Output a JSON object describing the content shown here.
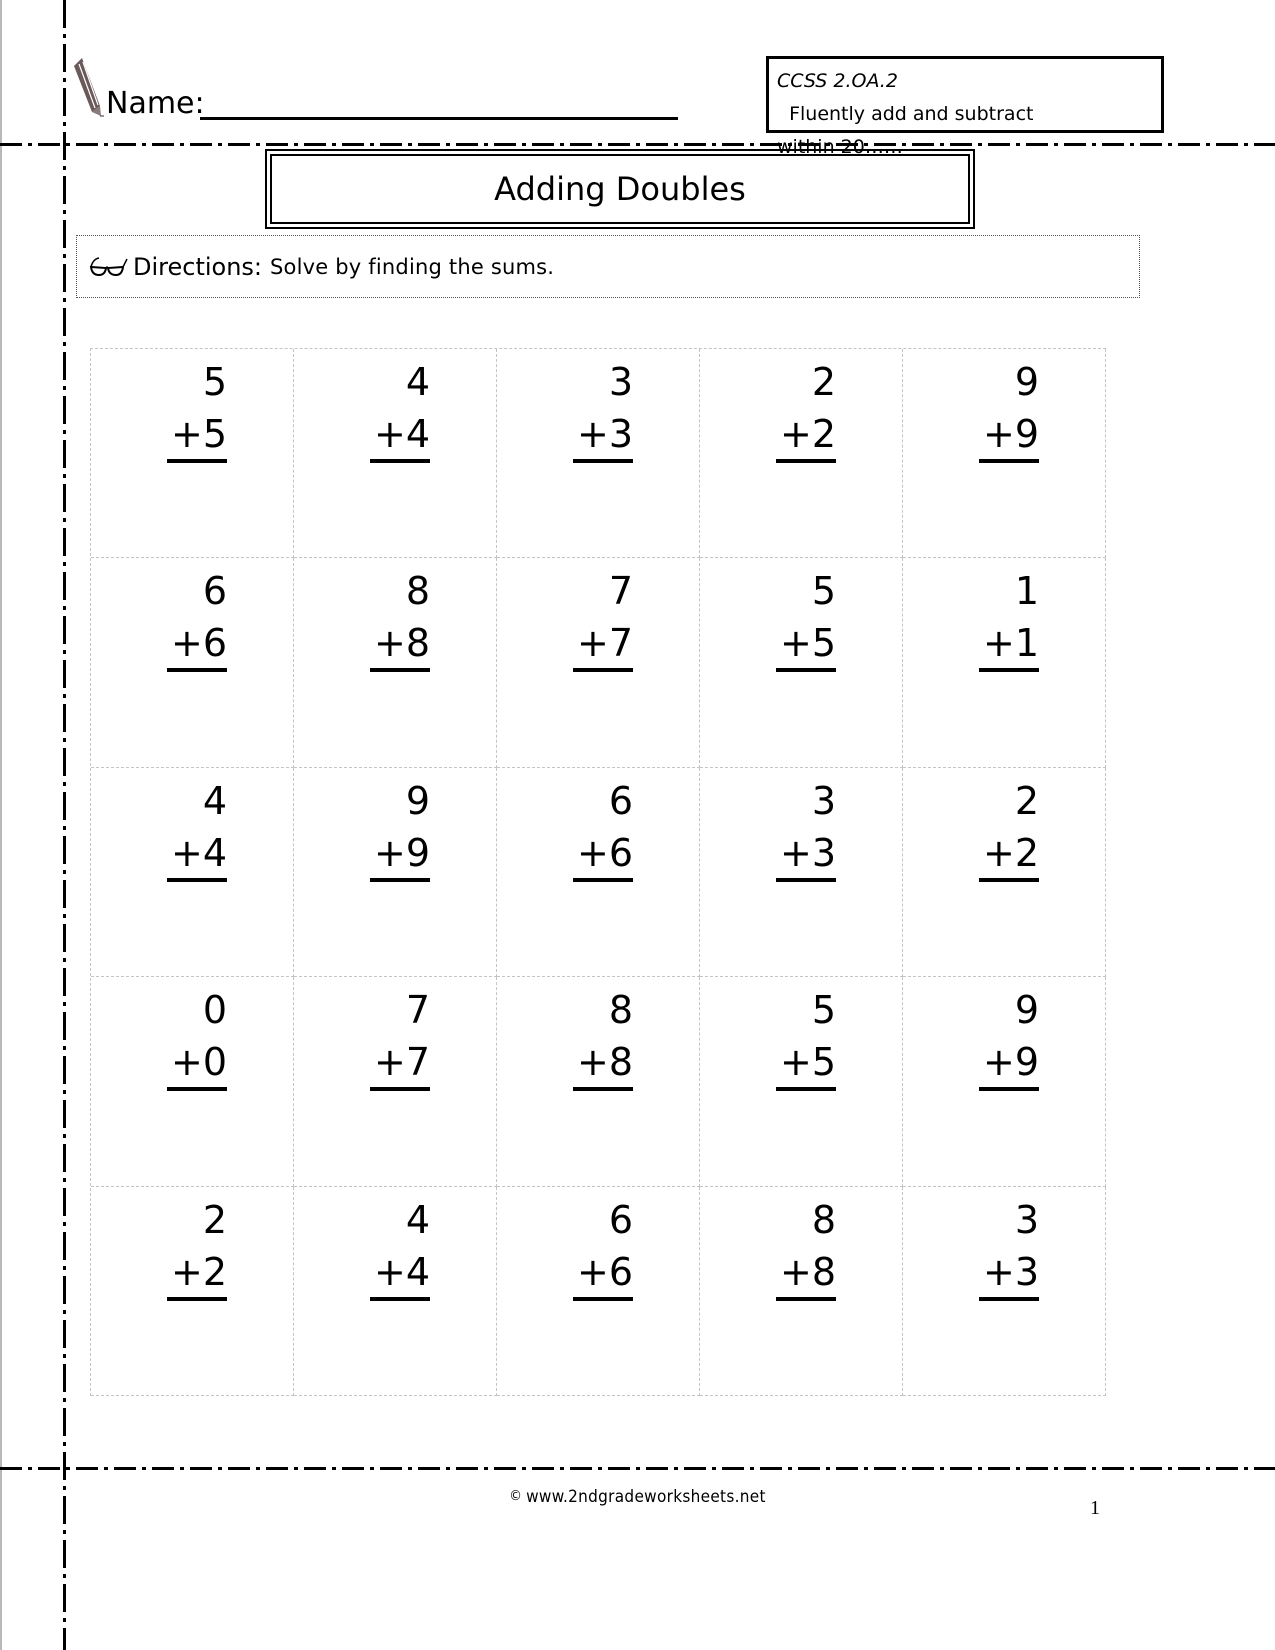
{
  "header": {
    "name_label": "Name:",
    "standard_code": "CCSS  2.OA.2",
    "standard_text_line1": "  Fluently add and subtract",
    "standard_text_line2": "within 20……",
    "icons": {
      "pencil": "pencil-icon",
      "glasses": "glasses-icon"
    }
  },
  "title": "Adding Doubles",
  "directions": {
    "label": "Directions:",
    "text": "Solve by finding the sums."
  },
  "problems": [
    [
      {
        "top": "5",
        "bottom": "5"
      },
      {
        "top": "4",
        "bottom": "4"
      },
      {
        "top": "3",
        "bottom": "3"
      },
      {
        "top": "2",
        "bottom": "2"
      },
      {
        "top": "9",
        "bottom": "9"
      }
    ],
    [
      {
        "top": "6",
        "bottom": "6"
      },
      {
        "top": "8",
        "bottom": "8"
      },
      {
        "top": "7",
        "bottom": "7"
      },
      {
        "top": "5",
        "bottom": "5"
      },
      {
        "top": "1",
        "bottom": "1"
      }
    ],
    [
      {
        "top": "4",
        "bottom": "4"
      },
      {
        "top": "9",
        "bottom": "9"
      },
      {
        "top": "6",
        "bottom": "6"
      },
      {
        "top": "3",
        "bottom": "3"
      },
      {
        "top": "2",
        "bottom": "2"
      }
    ],
    [
      {
        "top": "0",
        "bottom": "0"
      },
      {
        "top": "7",
        "bottom": "7"
      },
      {
        "top": "8",
        "bottom": "8"
      },
      {
        "top": "5",
        "bottom": "5"
      },
      {
        "top": "9",
        "bottom": "9"
      }
    ],
    [
      {
        "top": "2",
        "bottom": "2"
      },
      {
        "top": "4",
        "bottom": "4"
      },
      {
        "top": "6",
        "bottom": "6"
      },
      {
        "top": "8",
        "bottom": "8"
      },
      {
        "top": "3",
        "bottom": "3"
      }
    ]
  ],
  "operator": "+",
  "footer": {
    "copyright_symbol": "©",
    "site": "www.2ndgradeworksheets.net",
    "page_number": "1"
  }
}
